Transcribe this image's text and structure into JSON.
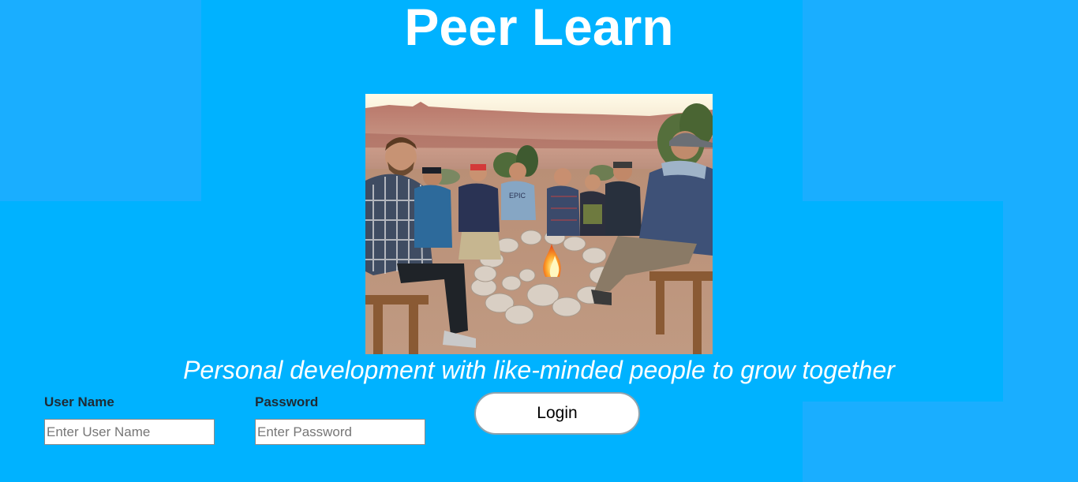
{
  "header": {
    "title": "Peer Learn"
  },
  "hero": {
    "image_alt": "Group of people sitting around a campfire in a desert canyon"
  },
  "tagline": "Personal development with like-minded people to grow together",
  "login_form": {
    "username": {
      "label": "User Name",
      "placeholder": "Enter User Name",
      "value": ""
    },
    "password": {
      "label": "Password",
      "placeholder": "Enter Password",
      "value": ""
    },
    "submit_label": "Login"
  },
  "colors": {
    "background": "#00b2ff",
    "background_block": "#1aaeff",
    "text_light": "#ffffff",
    "label_text": "#1f2a33"
  }
}
